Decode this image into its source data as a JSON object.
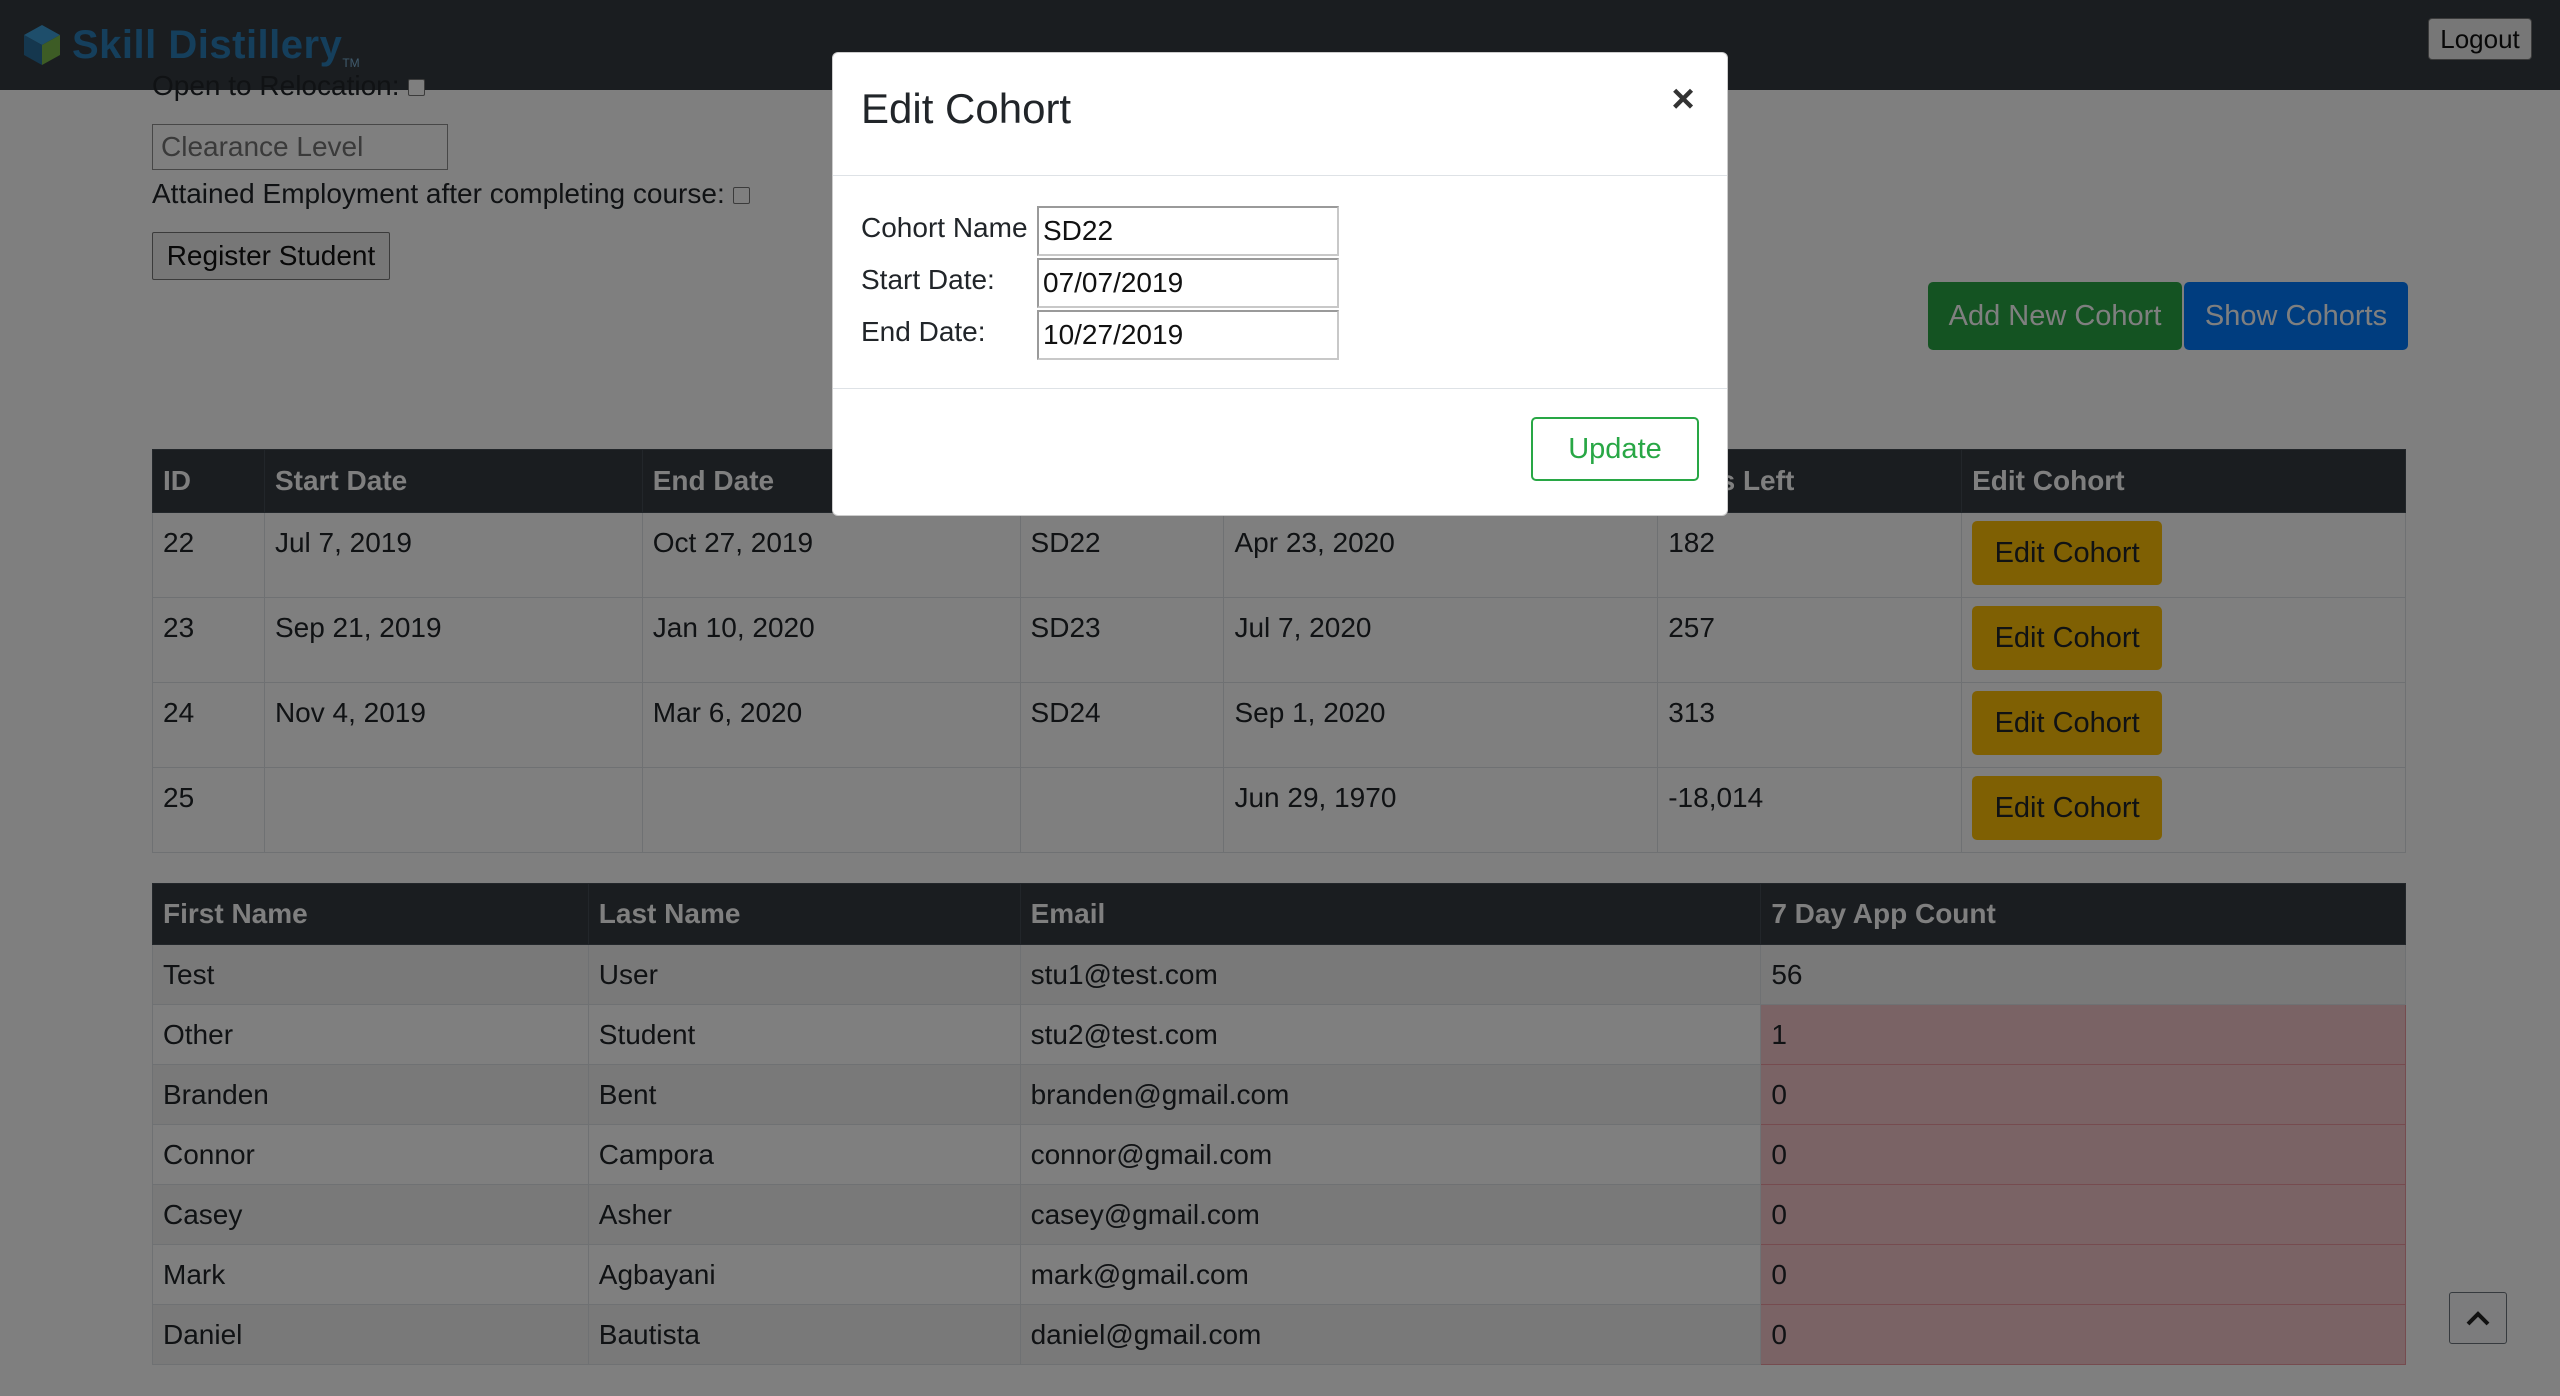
{
  "navbar": {
    "brand": "Skill Distillery",
    "brand_tm": "TM",
    "logout": "Logout"
  },
  "form": {
    "relocation_label": "Open to Relocation:",
    "clearance_placeholder": "Clearance Level",
    "employment_label": "Attained Employment after completing course:",
    "register_button": "Register Student"
  },
  "actions": {
    "add_cohort": "Add New Cohort",
    "show_cohorts": "Show Cohorts"
  },
  "cohort_table": {
    "headers": [
      "ID",
      "Start Date",
      "End Date",
      "",
      "",
      "Days Left",
      "Edit Cohort"
    ],
    "rows": [
      {
        "id": "22",
        "start": "Jul 7, 2019",
        "end": "Oct 27, 2019",
        "name": "SD22",
        "date": "Apr 23, 2020",
        "days": "182",
        "btn": "Edit Cohort"
      },
      {
        "id": "23",
        "start": "Sep 21, 2019",
        "end": "Jan 10, 2020",
        "name": "SD23",
        "date": "Jul 7, 2020",
        "days": "257",
        "btn": "Edit Cohort"
      },
      {
        "id": "24",
        "start": "Nov 4, 2019",
        "end": "Mar 6, 2020",
        "name": "SD24",
        "date": "Sep 1, 2020",
        "days": "313",
        "btn": "Edit Cohort"
      },
      {
        "id": "25",
        "start": "",
        "end": "",
        "name": "",
        "date": "Jun 29, 1970",
        "days": "-18,014",
        "btn": "Edit Cohort"
      }
    ]
  },
  "student_table": {
    "headers": [
      "First Name",
      "Last Name",
      "Email",
      "7 Day App Count"
    ],
    "rows": [
      {
        "first": "Test",
        "last": "User",
        "email": "stu1@test.com",
        "count": "56"
      },
      {
        "first": "Other",
        "last": "Student",
        "email": "stu2@test.com",
        "count": "1"
      },
      {
        "first": "Branden",
        "last": "Bent",
        "email": "branden@gmail.com",
        "count": "0"
      },
      {
        "first": "Connor",
        "last": "Campora",
        "email": "connor@gmail.com",
        "count": "0"
      },
      {
        "first": "Casey",
        "last": "Asher",
        "email": "casey@gmail.com",
        "count": "0"
      },
      {
        "first": "Mark",
        "last": "Agbayani",
        "email": "mark@gmail.com",
        "count": "0"
      },
      {
        "first": "Daniel",
        "last": "Bautista",
        "email": "daniel@gmail.com",
        "count": "0"
      }
    ]
  },
  "modal": {
    "title": "Edit Cohort",
    "close": "×",
    "cohort_name_label": "Cohort Name",
    "cohort_name_value": "SD22",
    "start_label": "Start Date:",
    "start_value": "07/07/2019",
    "end_label": "End Date:",
    "end_value": "10/27/2019",
    "update": "Update"
  },
  "colors": {
    "navbar": "#343a40",
    "success": "#28a745",
    "primary": "#007bff",
    "warning": "#ffc107",
    "danger_row": "#f5c6cb"
  },
  "icons": {
    "brand": "cube-logo-icon",
    "scroll_top": "chevron-up-icon"
  }
}
